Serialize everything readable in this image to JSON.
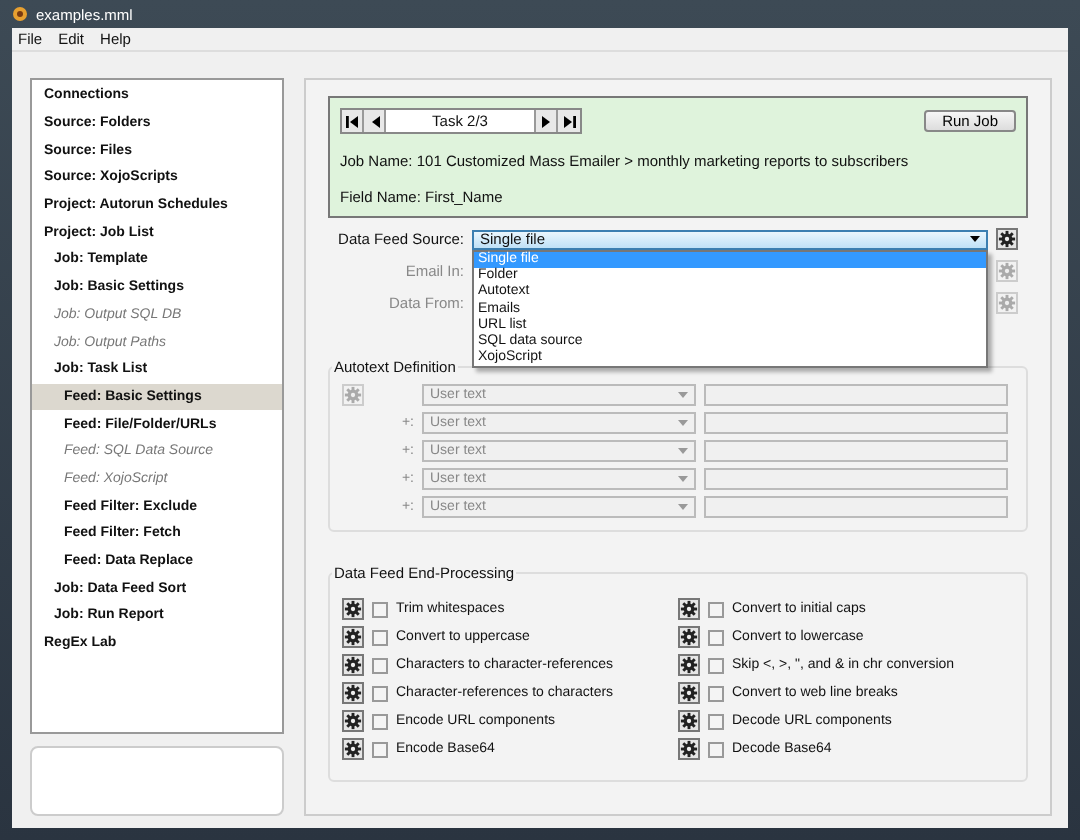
{
  "window": {
    "title": "examples.mml"
  },
  "menu": [
    "File",
    "Edit",
    "Help"
  ],
  "sidebar": {
    "items": [
      {
        "label": "Connections",
        "disabled": false,
        "selected": false
      },
      {
        "label": "Source: Folders",
        "disabled": false,
        "selected": false
      },
      {
        "label": "Source: Files",
        "disabled": false,
        "selected": false
      },
      {
        "label": "Source: XojoScripts",
        "disabled": false,
        "selected": false
      },
      {
        "label": "Project: Autorun Schedules",
        "disabled": false,
        "selected": false
      },
      {
        "label": "Project: Job List",
        "disabled": false,
        "selected": false,
        "children": [
          {
            "label": "Job: Template",
            "disabled": false,
            "selected": false
          },
          {
            "label": "Job: Basic Settings",
            "disabled": false,
            "selected": false
          },
          {
            "label": "Job: Output SQL DB",
            "disabled": true,
            "selected": false
          },
          {
            "label": "Job: Output Paths",
            "disabled": true,
            "selected": false
          },
          {
            "label": "Job: Task List",
            "disabled": false,
            "selected": false,
            "children": [
              {
                "label": "Feed: Basic Settings",
                "disabled": false,
                "selected": true
              },
              {
                "label": "Feed: File/Folder/URLs",
                "disabled": false,
                "selected": false
              },
              {
                "label": "Feed: SQL Data Source",
                "disabled": true,
                "selected": false
              },
              {
                "label": "Feed: XojoScript",
                "disabled": true,
                "selected": false
              },
              {
                "label": "Feed Filter: Exclude",
                "disabled": false,
                "selected": false
              },
              {
                "label": "Feed Filter: Fetch",
                "disabled": false,
                "selected": false
              },
              {
                "label": "Feed: Data Replace",
                "disabled": false,
                "selected": false
              }
            ]
          },
          {
            "label": "Job: Data Feed Sort",
            "disabled": false,
            "selected": false
          },
          {
            "label": "Job: Run Report",
            "disabled": false,
            "selected": false
          }
        ]
      },
      {
        "label": "RegEx Lab",
        "disabled": false,
        "selected": false
      }
    ]
  },
  "task_box": {
    "task": "Task 2/3",
    "run_button": "Run Job",
    "job_name": "Job Name: 101 Customized Mass Emailer > monthly marketing reports to subscribers",
    "field_name": "Field Name: First_Name"
  },
  "feed_source": {
    "label": "Data Feed Source:",
    "value": "Single file",
    "expanded": true,
    "options": [
      {
        "label": "Single file",
        "selected": true
      },
      {
        "label": "Folder",
        "selected": false
      },
      {
        "label": "Autotext",
        "selected": false
      },
      {
        "label": "Emails",
        "selected": false
      },
      {
        "label": "URL list",
        "selected": false
      },
      {
        "label": "SQL data source",
        "selected": false
      },
      {
        "label": "XojoScript",
        "selected": false
      }
    ]
  },
  "hidden_fields": [
    {
      "label": "Email In:",
      "disabled": true
    },
    {
      "label": "Data From:",
      "disabled": true
    }
  ],
  "autotext": {
    "title": "Autotext Definition",
    "rows": [
      {
        "value": "User text",
        "disabled": true
      },
      {
        "prefix": "+:",
        "value": "User text",
        "disabled": true
      },
      {
        "prefix": "+:",
        "value": "User text",
        "disabled": true
      },
      {
        "prefix": "+:",
        "value": "User text",
        "disabled": true
      },
      {
        "prefix": "+:",
        "value": "User text",
        "disabled": true
      }
    ]
  },
  "end_processing": {
    "title": "Data Feed End-Processing",
    "options": [
      {
        "label": "Trim whitespaces",
        "checked": false
      },
      {
        "label": "Convert to uppercase",
        "checked": false
      },
      {
        "label": "Characters to character-references",
        "checked": false
      },
      {
        "label": "Character-references to characters",
        "checked": false
      },
      {
        "label": "Encode URL components",
        "checked": false
      },
      {
        "label": "Encode Base64",
        "checked": false
      },
      {
        "label": "Convert to initial caps",
        "checked": false
      },
      {
        "label": "Convert to lowercase",
        "checked": false
      },
      {
        "label": "Skip <, >, \", and & in chr conversion",
        "checked": false
      },
      {
        "label": "Convert to web line breaks",
        "checked": false
      },
      {
        "label": "Decode URL components",
        "checked": false
      },
      {
        "label": "Decode Base64",
        "checked": false
      }
    ]
  }
}
